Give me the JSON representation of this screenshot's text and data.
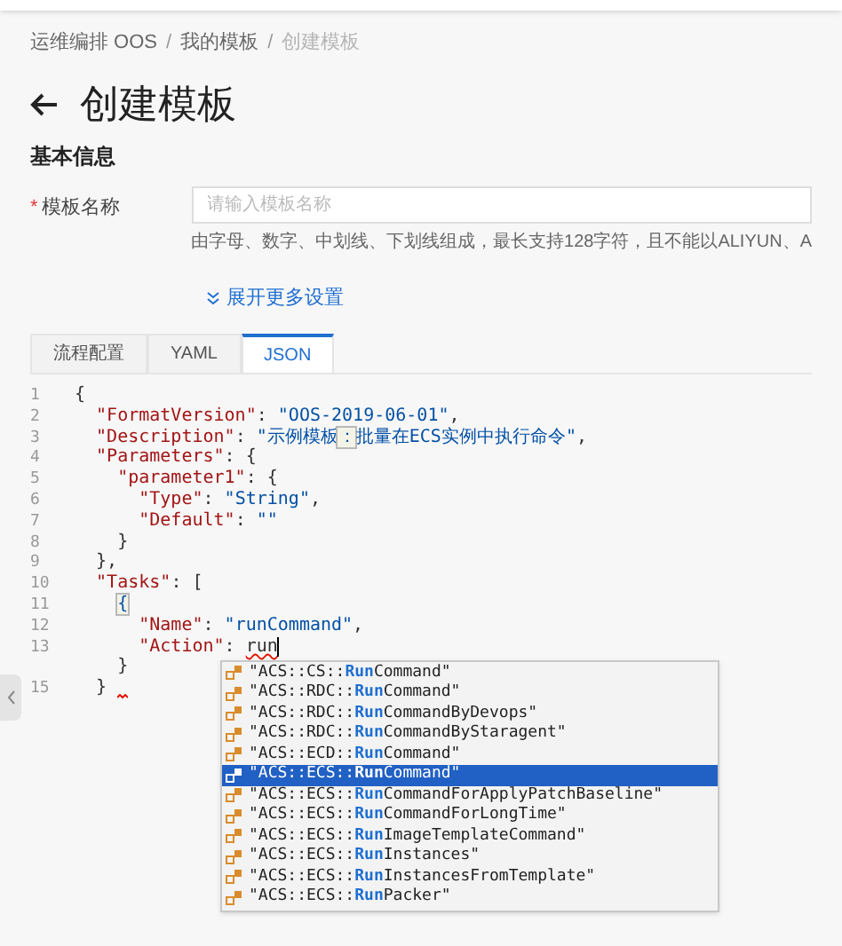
{
  "breadcrumb": [
    {
      "label": "运维编排 OOS",
      "current": false
    },
    {
      "label": "我的模板",
      "current": false
    },
    {
      "label": "创建模板",
      "current": true
    }
  ],
  "breadcrumb_separator": "/",
  "title": "创建模板",
  "section_title": "基本信息",
  "form": {
    "label": "模板名称",
    "required_mark": "*",
    "placeholder": "请输入模板名称",
    "hint": "由字母、数字、中划线、下划线组成，最长支持128字符，且不能以ALIYUN、A",
    "expand_link": "展开更多设置"
  },
  "tabs": [
    {
      "label": "流程配置",
      "selected": false
    },
    {
      "label": "YAML",
      "selected": false
    },
    {
      "label": "JSON",
      "selected": true
    }
  ],
  "editor": {
    "lines": [
      {
        "number": "1",
        "tokens": [
          {
            "kind": "punct",
            "text": "{"
          }
        ]
      },
      {
        "number": "2",
        "tokens": [
          {
            "kind": "key",
            "text": "  \"FormatVersion\""
          },
          {
            "kind": "punct",
            "text": ": "
          },
          {
            "kind": "string",
            "text": "\"OOS-2019-06-01\""
          },
          {
            "kind": "punct",
            "text": ","
          }
        ]
      },
      {
        "number": "3",
        "tokens": [
          {
            "kind": "key",
            "text": "  \"Description\""
          },
          {
            "kind": "punct",
            "text": ": "
          },
          {
            "kind": "string",
            "text": "\"示例模板"
          },
          {
            "kind": "match",
            "text": "："
          },
          {
            "kind": "string",
            "text": "批量在ECS实例中执行命令\""
          },
          {
            "kind": "punct",
            "text": ","
          }
        ]
      },
      {
        "number": "4",
        "tokens": [
          {
            "kind": "key",
            "text": "  \"Parameters\""
          },
          {
            "kind": "punct",
            "text": ": {"
          }
        ]
      },
      {
        "number": "5",
        "tokens": [
          {
            "kind": "key",
            "text": "    \"parameter1\""
          },
          {
            "kind": "punct",
            "text": ": {"
          }
        ]
      },
      {
        "number": "6",
        "tokens": [
          {
            "kind": "key",
            "text": "      \"Type\""
          },
          {
            "kind": "punct",
            "text": ": "
          },
          {
            "kind": "string",
            "text": "\"String\""
          },
          {
            "kind": "punct",
            "text": ","
          }
        ]
      },
      {
        "number": "7",
        "tokens": [
          {
            "kind": "key",
            "text": "      \"Default\""
          },
          {
            "kind": "punct",
            "text": ": "
          },
          {
            "kind": "string",
            "text": "\"\""
          }
        ]
      },
      {
        "number": "8",
        "tokens": [
          {
            "kind": "punct",
            "text": "    }"
          }
        ]
      },
      {
        "number": "9",
        "tokens": [
          {
            "kind": "punct",
            "text": "  },"
          }
        ]
      },
      {
        "number": "10",
        "tokens": [
          {
            "kind": "key",
            "text": "  \"Tasks\""
          },
          {
            "kind": "punct",
            "text": ": ["
          }
        ]
      },
      {
        "number": "11",
        "tokens": [
          {
            "kind": "match",
            "text": "    {"
          }
        ]
      },
      {
        "number": "12",
        "tokens": [
          {
            "kind": "key",
            "text": "      \"Name\""
          },
          {
            "kind": "punct",
            "text": ": "
          },
          {
            "kind": "string",
            "text": "\"runCommand\""
          },
          {
            "kind": "punct",
            "text": ","
          }
        ]
      },
      {
        "number": "13",
        "cursor": true,
        "tokens": [
          {
            "kind": "key",
            "text": "      \"Action\""
          },
          {
            "kind": "punct",
            "text": ": "
          },
          {
            "kind": "error",
            "text": "run"
          }
        ]
      },
      {
        "tokens": [
          {
            "kind": "punct",
            "text": "    }"
          }
        ]
      },
      {
        "number": "15",
        "error_after": true,
        "tokens": [
          {
            "kind": "punct",
            "text": "  }"
          }
        ]
      }
    ]
  },
  "suggestions": [
    {
      "prefix": "\"ACS::CS::",
      "match": "Run",
      "suffix": "Command\"",
      "selected": false
    },
    {
      "prefix": "\"ACS::RDC::",
      "match": "Run",
      "suffix": "Command\"",
      "selected": false
    },
    {
      "prefix": "\"ACS::RDC::",
      "match": "Run",
      "suffix": "CommandByDevops\"",
      "selected": false
    },
    {
      "prefix": "\"ACS::RDC::",
      "match": "Run",
      "suffix": "CommandByStaragent\"",
      "selected": false
    },
    {
      "prefix": "\"ACS::ECD::",
      "match": "Run",
      "suffix": "Command\"",
      "selected": false
    },
    {
      "prefix": "\"ACS::ECS::",
      "match": "Run",
      "suffix": "Command\"",
      "selected": true
    },
    {
      "prefix": "\"ACS::ECS::",
      "match": "Run",
      "suffix": "CommandForApplyPatchBaseline\"",
      "selected": false
    },
    {
      "prefix": "\"ACS::ECS::",
      "match": "Run",
      "suffix": "CommandForLongTime\"",
      "selected": false
    },
    {
      "prefix": "\"ACS::ECS::",
      "match": "Run",
      "suffix": "ImageTemplateCommand\"",
      "selected": false
    },
    {
      "prefix": "\"ACS::ECS::",
      "match": "Run",
      "suffix": "Instances\"",
      "selected": false
    },
    {
      "prefix": "\"ACS::ECS::",
      "match": "Run",
      "suffix": "InstancesFromTemplate\"",
      "selected": false
    },
    {
      "prefix": "\"ACS::ECS::",
      "match": "Run",
      "suffix": "Packer\"",
      "selected": false
    }
  ]
}
